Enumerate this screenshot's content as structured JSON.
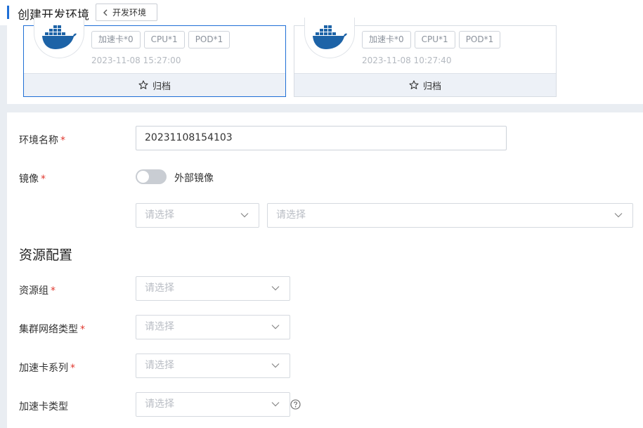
{
  "header": {
    "title": "创建开发环境",
    "back_label": "开发环境"
  },
  "cards": [
    {
      "tags": [
        "加速卡*0",
        "CPU*1",
        "POD*1"
      ],
      "time": "2023-11-08 15:27:00",
      "action_label": "归档",
      "selected": true
    },
    {
      "tags": [
        "加速卡*0",
        "CPU*1",
        "POD*1"
      ],
      "time": "2023-11-08 10:27:40",
      "action_label": "归档",
      "selected": false
    }
  ],
  "form": {
    "env_name_label": "环境名称",
    "env_name_value": "20231108154103",
    "image_label": "镜像",
    "external_image_label": "外部镜像",
    "image_select_1": "请选择",
    "image_select_2": "请选择",
    "section_title": "资源配置",
    "resource_group_label": "资源组",
    "resource_group_value": "请选择",
    "cluster_net_label": "集群网络类型",
    "cluster_net_value": "请选择",
    "accel_series_label": "加速卡系列",
    "accel_series_value": "请选择",
    "accel_type_label": "加速卡类型",
    "accel_type_value": "请选择",
    "required_mark": "*"
  },
  "colors": {
    "accent": "#1f6fd6",
    "required": "#e0382f",
    "docker_blue": "#1d63a7"
  },
  "icons": [
    "docker-icon",
    "star-icon",
    "chevron-left-icon",
    "chevron-down-icon",
    "help-icon"
  ]
}
